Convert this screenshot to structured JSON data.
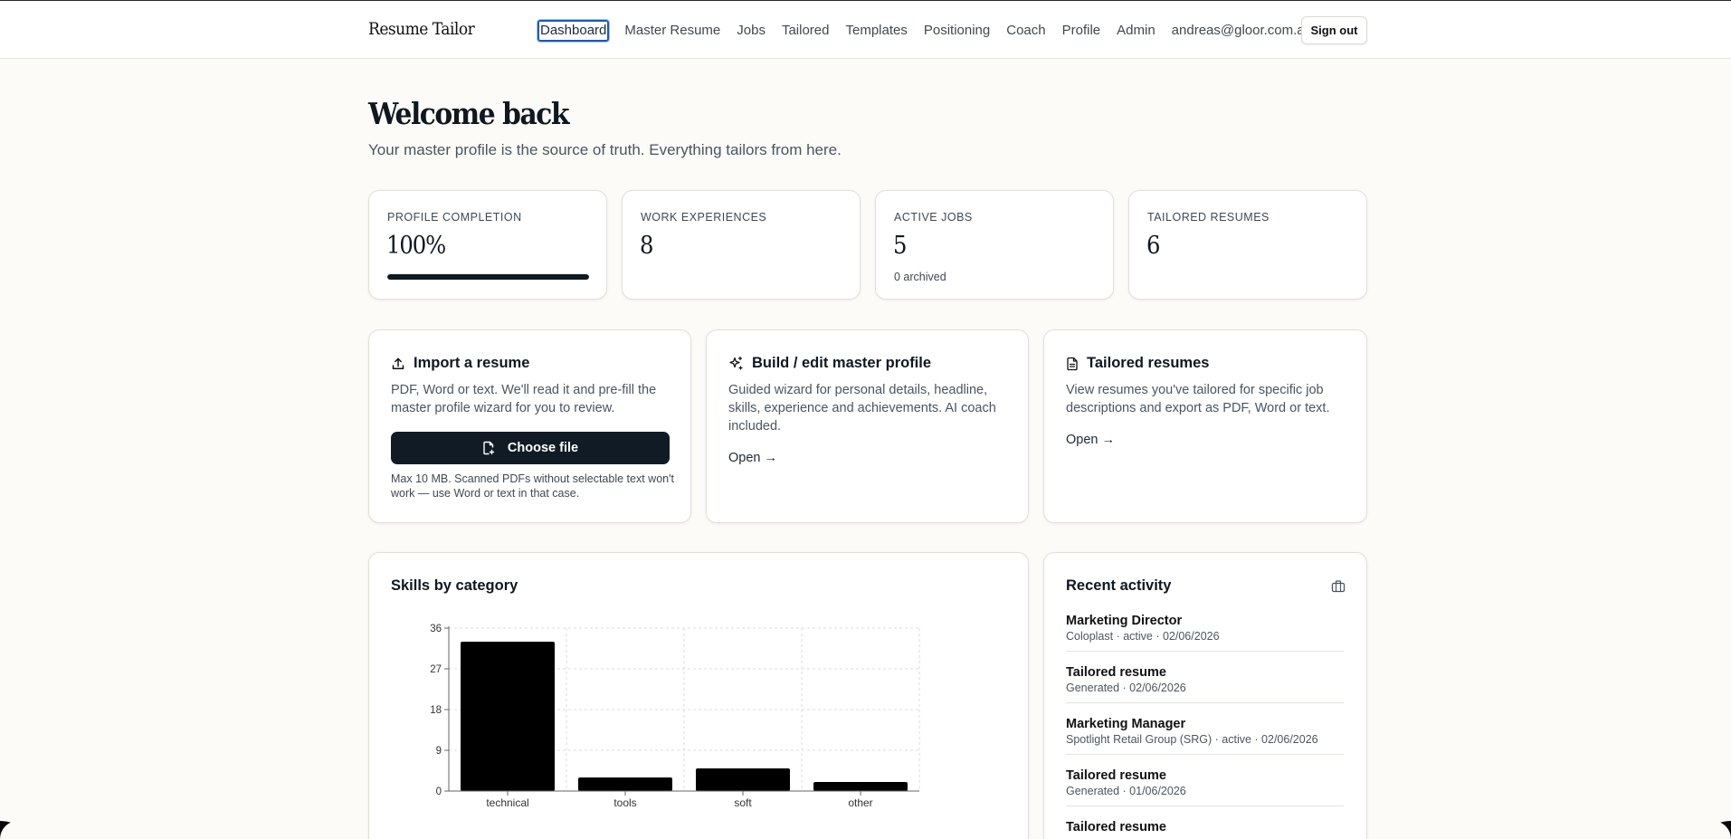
{
  "app": {
    "brand": "Resume Tailor"
  },
  "nav": {
    "items": [
      "Dashboard",
      "Master Resume",
      "Jobs",
      "Tailored",
      "Templates",
      "Positioning",
      "Coach",
      "Profile",
      "Admin"
    ],
    "active": "Dashboard",
    "user_email": "andreas@gloor.com.au",
    "sign_out_label": "Sign out"
  },
  "page": {
    "title": "Welcome back",
    "subtitle": "Your master profile is the source of truth. Everything tailors from here."
  },
  "stats": {
    "profile_completion": {
      "label": "PROFILE COMPLETION",
      "value": "100%",
      "progress_fraction": 1.0
    },
    "work_experiences": {
      "label": "WORK EXPERIENCES",
      "value": "8"
    },
    "active_jobs": {
      "label": "ACTIVE JOBS",
      "value": "5",
      "sub": "0 archived"
    },
    "tailored_resumes": {
      "label": "TAILORED RESUMES",
      "value": "6"
    }
  },
  "features": {
    "import": {
      "title": "Import a resume",
      "icon": "upload-icon",
      "description": "PDF, Word or text. We'll read it and pre-fill the master profile wizard for you to review.",
      "button_label": "Choose file",
      "note": "Max 10 MB. Scanned PDFs without selectable text won't work — use Word or text in that case."
    },
    "build": {
      "title": "Build / edit master profile",
      "icon": "sparkles-icon",
      "description": "Guided wizard for personal details, headline, skills, experience and achievements. AI coach included.",
      "link_label": "Open →"
    },
    "tailored": {
      "title": "Tailored resumes",
      "icon": "document-icon",
      "description": "View resumes you've tailored for specific job descriptions and export as PDF, Word or text.",
      "link_label": "Open →"
    }
  },
  "skills_chart": {
    "title": "Skills by category",
    "bar_color": "#000000"
  },
  "chart_data": {
    "type": "bar",
    "categories": [
      "technical",
      "tools",
      "soft",
      "other"
    ],
    "values": [
      33,
      3,
      5,
      2
    ],
    "title": "Skills by category",
    "xlabel": "",
    "ylabel": "",
    "ylim": [
      0,
      36
    ],
    "yticks": [
      0,
      9,
      18,
      27,
      36
    ],
    "grid": true
  },
  "recent_activity": {
    "title": "Recent activity",
    "icon": "briefcase-icon",
    "items": [
      {
        "title": "Marketing Director",
        "meta": "Coloplast · active · 02/06/2026"
      },
      {
        "title": "Tailored resume",
        "meta": "Generated · 02/06/2026"
      },
      {
        "title": "Marketing Manager",
        "meta": "Spotlight Retail Group (SRG) · active · 02/06/2026"
      },
      {
        "title": "Tailored resume",
        "meta": "Generated · 01/06/2026"
      },
      {
        "title": "Tailored resume",
        "meta": ""
      }
    ]
  }
}
